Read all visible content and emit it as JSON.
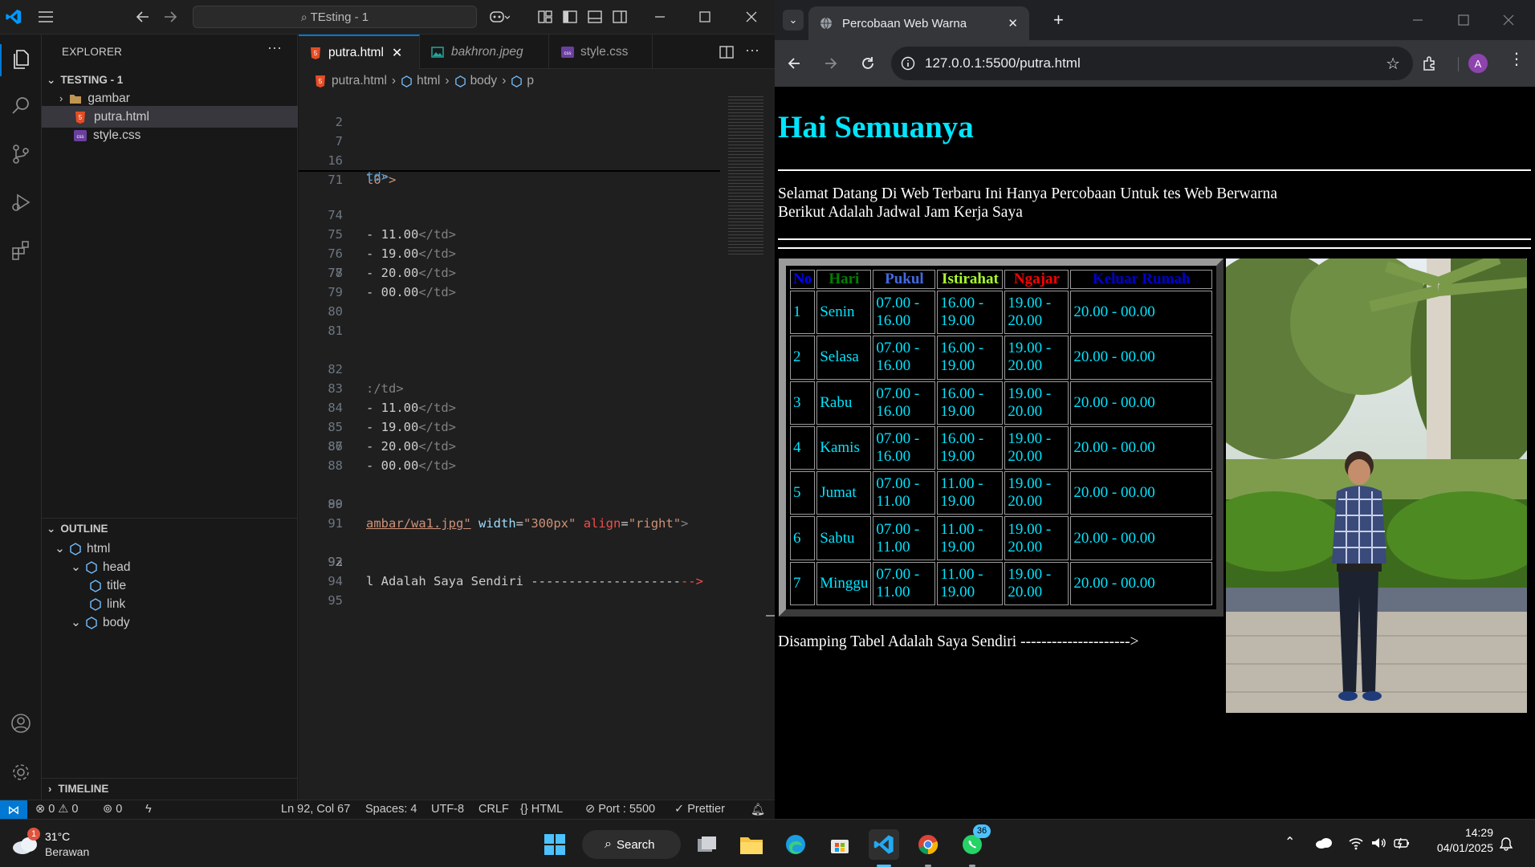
{
  "vscode": {
    "search_text": "TEsting - 1",
    "explorer": {
      "title": "EXPLORER",
      "project": "TESTING - 1",
      "items": [
        {
          "label": "gambar",
          "kind": "folder"
        },
        {
          "label": "putra.html",
          "kind": "html"
        },
        {
          "label": "style.css",
          "kind": "css"
        }
      ]
    },
    "outline": {
      "title": "OUTLINE",
      "items": [
        {
          "label": "html"
        },
        {
          "label": "head"
        },
        {
          "label": "title"
        },
        {
          "label": "link"
        },
        {
          "label": "body"
        }
      ]
    },
    "timeline_title": "TIMELINE",
    "tabs": [
      {
        "label": "putra.html",
        "active": true
      },
      {
        "label": "bakhron.jpeg",
        "active": false
      },
      {
        "label": "style.css",
        "active": false
      }
    ],
    "breadcrumb": [
      "putra.html",
      "html",
      "body",
      "p"
    ],
    "sticky_lines": [
      {
        "n": "2",
        "text": ""
      },
      {
        "n": "7",
        "text": ""
      },
      {
        "n": "16",
        "text": "l0\">"
      },
      {
        "n": "71",
        "text": ""
      }
    ],
    "code_lines": [
      {
        "n": "74",
        "pre": "- ",
        "text": "11.00",
        "post": "</td>"
      },
      {
        "n": "75",
        "pre": "- ",
        "text": "19.00",
        "post": "</td>"
      },
      {
        "n": "76",
        "pre": "- ",
        "text": "20.00",
        "post": "</td>"
      },
      {
        "n": "77",
        "pre": "- ",
        "text": "00.00",
        "post": "</td>"
      },
      {
        "n": "78",
        "pre": "",
        "text": "",
        "post": ""
      },
      {
        "n": "79",
        "pre": "",
        "text": "",
        "post": ""
      },
      {
        "n": "80",
        "pre": "",
        "text": "",
        "post": ""
      },
      {
        "n": "81",
        "pre": "",
        "text": "",
        "post": ""
      },
      {
        "n": "82",
        "pre": ":",
        "text": "",
        "post": "/td>"
      },
      {
        "n": "83",
        "pre": "- ",
        "text": "11.00",
        "post": "</td>"
      },
      {
        "n": "84",
        "pre": "- ",
        "text": "19.00",
        "post": "</td>"
      },
      {
        "n": "85",
        "pre": "- ",
        "text": "20.00",
        "post": "</td>"
      },
      {
        "n": "86",
        "pre": "- ",
        "text": "00.00",
        "post": "</td>"
      },
      {
        "n": "87",
        "pre": "",
        "text": "",
        "post": ""
      },
      {
        "n": "88",
        "pre": "",
        "text": "",
        "post": ""
      },
      {
        "n": "89",
        "pre": "",
        "text": "",
        "post": ""
      },
      {
        "n": "90",
        "pre": "",
        "text": "",
        "post": ""
      },
      {
        "n": "91",
        "pre": "",
        "text": "",
        "post": ""
      },
      {
        "n": "92",
        "pre": "",
        "text": "",
        "post": ""
      },
      {
        "n": "93",
        "pre": "",
        "text": "",
        "post": ""
      },
      {
        "n": "94",
        "pre": "",
        "text": "",
        "post": ""
      },
      {
        "n": "95",
        "pre": "",
        "text": "",
        "post": ""
      }
    ],
    "line89": {
      "src": "ambar/wa1.jpg\"",
      "w_attr": "width",
      "w_val": "\"300px\"",
      "a_attr": "align",
      "a_val": "\"right\"",
      "end": ">"
    },
    "line92": {
      "text": "l Adalah Saya Sendiri --------------------",
      "end": "-->"
    },
    "status": {
      "errors": "0",
      "warnings": "0",
      "ports": "0",
      "position": "Ln 92, Col 67",
      "spaces": "Spaces: 4",
      "encoding": "UTF-8",
      "eol": "CRLF",
      "language": "HTML",
      "port": "Port : 5500",
      "prettier": "Prettier"
    }
  },
  "browser": {
    "tab_title": "Percobaan Web Warna",
    "url": "127.0.0.1:5500/putra.html",
    "profile_initial": "A",
    "page": {
      "heading": "Hai Semuanya",
      "intro_line1": "Selamat Datang Di Web Terbaru Ini Hanya Percobaan Untuk tes Web Berwarna",
      "intro_line2": "Berikut Adalah Jadwal Jam Kerja Saya",
      "table": {
        "headers": [
          {
            "label": "No",
            "color": "#0000ff"
          },
          {
            "label": "Hari",
            "color": "#008000"
          },
          {
            "label": "Pukul",
            "color": "#4169e1"
          },
          {
            "label": "Istirahat",
            "color": "#adff2f"
          },
          {
            "label": "Ngajar",
            "color": "#ff0000"
          },
          {
            "label": "Keluar Rumah",
            "color": "#0000cd"
          }
        ],
        "rows": [
          [
            "1",
            "Senin",
            "07.00 - 16.00",
            "16.00 - 19.00",
            "19.00 - 20.00",
            "20.00 - 00.00"
          ],
          [
            "2",
            "Selasa",
            "07.00 - 16.00",
            "16.00 - 19.00",
            "19.00 - 20.00",
            "20.00 - 00.00"
          ],
          [
            "3",
            "Rabu",
            "07.00 - 16.00",
            "16.00 - 19.00",
            "19.00 - 20.00",
            "20.00 - 00.00"
          ],
          [
            "4",
            "Kamis",
            "07.00 - 16.00",
            "16.00 - 19.00",
            "19.00 - 20.00",
            "20.00 - 00.00"
          ],
          [
            "5",
            "Jumat",
            "07.00 - 11.00",
            "11.00 - 19.00",
            "19.00 - 20.00",
            "20.00 - 00.00"
          ],
          [
            "6",
            "Sabtu",
            "07.00 - 11.00",
            "11.00 - 19.00",
            "19.00 - 20.00",
            "20.00 - 00.00"
          ],
          [
            "7",
            "Minggu",
            "07.00 - 11.00",
            "11.00 - 19.00",
            "19.00 - 20.00",
            "20.00 - 00.00"
          ]
        ],
        "text_color": "#00e5ff"
      },
      "caption": "Disamping Tabel Adalah Saya Sendiri --------------------->"
    }
  },
  "taskbar": {
    "weather_temp": "31°C",
    "weather_desc": "Berawan",
    "weather_badge": "1",
    "search_label": "Search",
    "whatsapp_badge": "36",
    "time": "14:29",
    "date": "04/01/2025"
  },
  "colors": {
    "vscode_accent": "#0078d4",
    "heading_cyan": "#00e5ff",
    "html_icon": "#e44d26",
    "css_icon": "#6b3fa0"
  }
}
